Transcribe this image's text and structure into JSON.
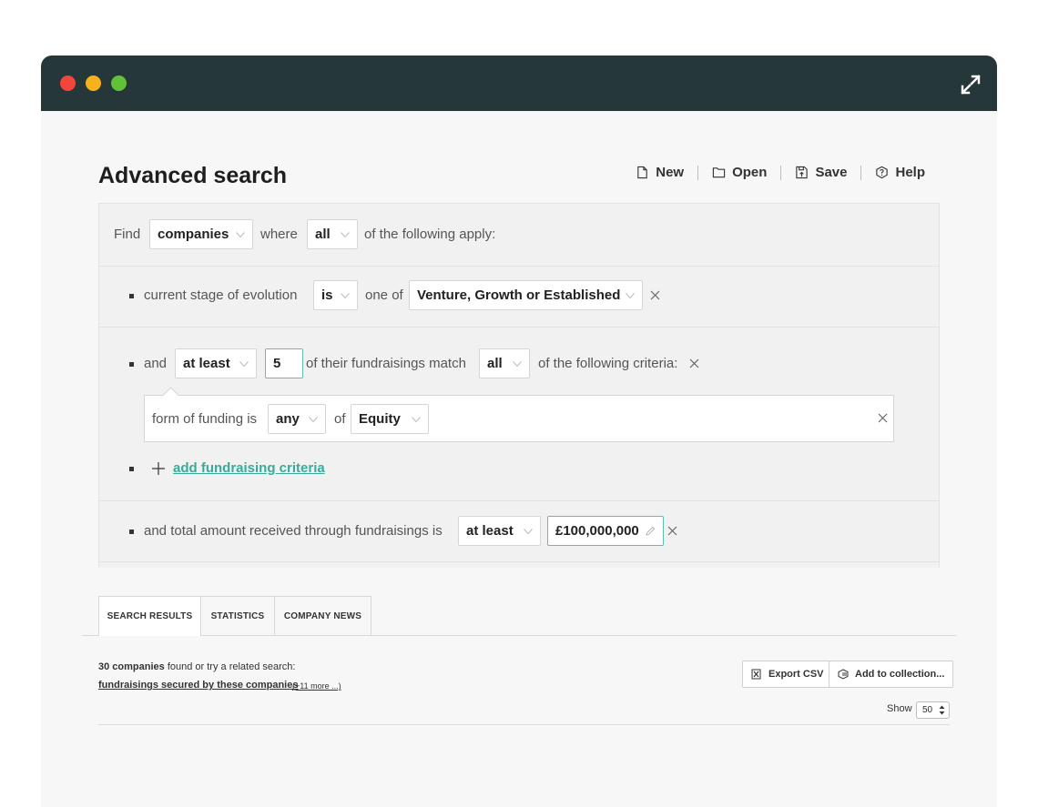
{
  "page": {
    "title": "Advanced search"
  },
  "toolbar": {
    "new_label": "New",
    "open_label": "Open",
    "save_label": "Save",
    "help_label": "Help"
  },
  "criteria": {
    "find": {
      "find_label": "Find",
      "entity": "companies",
      "where_label": "where",
      "quantifier": "all",
      "suffix": "of the following apply:"
    },
    "stage": {
      "label": "current stage of evolution",
      "operator": "is",
      "one_of_label": "one of",
      "value": "Venture, Growth or Established"
    },
    "fundraisings": {
      "and_label": "and",
      "comparator": "at least",
      "count": "5",
      "match_label": "of their fundraisings match",
      "quantifier": "all",
      "suffix": "of the following criteria:",
      "sub": {
        "label": "form of funding is",
        "quantifier": "any",
        "of_label": "of",
        "value": "Equity"
      },
      "add_label": "add fundraising criteria"
    },
    "total": {
      "label": "and total amount received through fundraisings is",
      "comparator": "at least",
      "amount": "£100,000,000"
    }
  },
  "tabs": [
    {
      "label": "SEARCH RESULTS",
      "active": true
    },
    {
      "label": "STATISTICS",
      "active": false
    },
    {
      "label": "COMPANY NEWS",
      "active": false
    }
  ],
  "results": {
    "count_text": "30 companies",
    "found_text": " found or try a related search:",
    "related_link": "fundraisings secured by these companies",
    "more_link": "(+11 more ...)",
    "export_label": "Export CSV",
    "collection_label": "Add to collection...",
    "show_label": "Show",
    "show_value": "50"
  },
  "colors": {
    "titlebar": "#263739",
    "accent": "#3aaa9a",
    "input_border": "#5ec0b3"
  }
}
